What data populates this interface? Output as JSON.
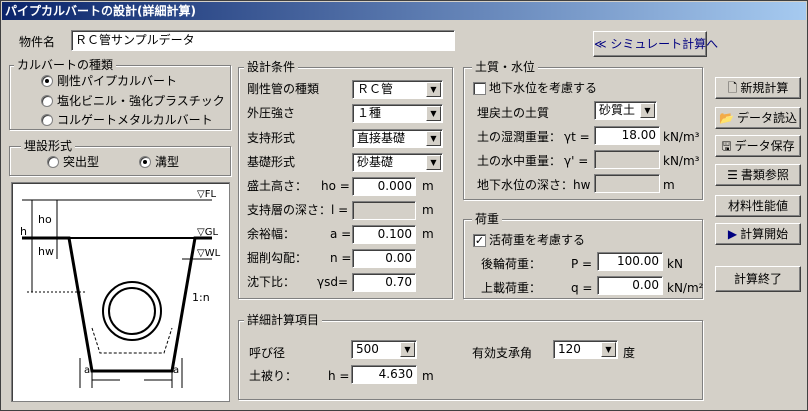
{
  "window": {
    "title": "パイプカルバートの設計(詳細計算)"
  },
  "project": {
    "label": "物件名",
    "value": "ＲＣ管サンプルデータ"
  },
  "simulate_button": "≪ シミュレート計算へ",
  "culvert_type": {
    "title": "カルバートの種類",
    "options": [
      {
        "label": "剛性パイプカルバート",
        "selected": true
      },
      {
        "label": "塩化ビニル・強化プラスチック",
        "selected": false
      },
      {
        "label": "コルゲートメタルカルバート",
        "selected": false
      }
    ]
  },
  "burial": {
    "title": "埋設形式",
    "options": [
      {
        "label": "突出型",
        "selected": false
      },
      {
        "label": "溝型",
        "selected": true
      }
    ]
  },
  "diagram": {
    "fl": "▽FL",
    "gl": "▽GL",
    "wl": "▽WL",
    "h": "h",
    "ho": "ho",
    "hw": "hw",
    "slope": "1:n",
    "a_left": "a",
    "a_right": "a"
  },
  "design": {
    "title": "設計条件",
    "pipe_type": {
      "label": "剛性管の種類",
      "value": "ＲＣ管"
    },
    "external_pressure": {
      "label": "外圧強さ",
      "value": "１種"
    },
    "support": {
      "label": "支持形式",
      "value": "直接基礎"
    },
    "foundation": {
      "label": "基礎形式",
      "value": "砂基礎"
    },
    "fill_height": {
      "label": "盛土高さ：",
      "sym": "ho =",
      "value": "0.000",
      "unit": "m"
    },
    "support_depth": {
      "label": "支持層の深さ：",
      "sym": "l =",
      "value": "",
      "unit": "m"
    },
    "margin": {
      "label": "余裕幅：",
      "sym": "a =",
      "value": "0.100",
      "unit": "m"
    },
    "slope": {
      "label": "掘削勾配：",
      "sym": "n =",
      "value": "0.00"
    },
    "settlement": {
      "label": "沈下比：",
      "sym": "γsd=",
      "value": "0.70"
    }
  },
  "soil": {
    "title": "土質・水位",
    "groundwater_check": {
      "label": "地下水位を考慮する",
      "checked": false
    },
    "backfill": {
      "label": "埋戻土の土質",
      "value": "砂質土"
    },
    "wet_weight": {
      "label": "土の湿潤重量：",
      "sym": "γt =",
      "value": "18.00",
      "unit": "kN/m³"
    },
    "sub_weight": {
      "label": "土の水中重量：",
      "sym": "γ' =",
      "value": "",
      "unit": "kN/m³"
    },
    "gw_depth": {
      "label": "地下水位の深さ：hw =",
      "value": "",
      "unit": "m"
    }
  },
  "load": {
    "title": "荷重",
    "live_check": {
      "label": "活荷重を考慮する",
      "checked": true
    },
    "rear_wheel": {
      "label": "後輪荷重：",
      "sym": "P =",
      "value": "100.00",
      "unit": "kN"
    },
    "surcharge": {
      "label": "上載荷重：",
      "sym": "q =",
      "value": "0.00",
      "unit": "kN/m²"
    }
  },
  "detail": {
    "title": "詳細計算項目",
    "diameter": {
      "label": "呼び径",
      "value": "500"
    },
    "cover": {
      "label": "土被り：",
      "sym": "h =",
      "value": "4.630",
      "unit": "m"
    },
    "angle": {
      "label": "有効支承角",
      "value": "120",
      "unit": "度"
    }
  },
  "side_buttons": {
    "new": "新規計算",
    "load": "データ読込",
    "save": "データ保存",
    "reference": "書類参照",
    "material": "材料性能値",
    "start": "計算開始",
    "end": "計算終了"
  },
  "colors": {
    "title_start": "#0a246a",
    "title_end": "#a6caf0",
    "face": "#d4d0c8"
  }
}
